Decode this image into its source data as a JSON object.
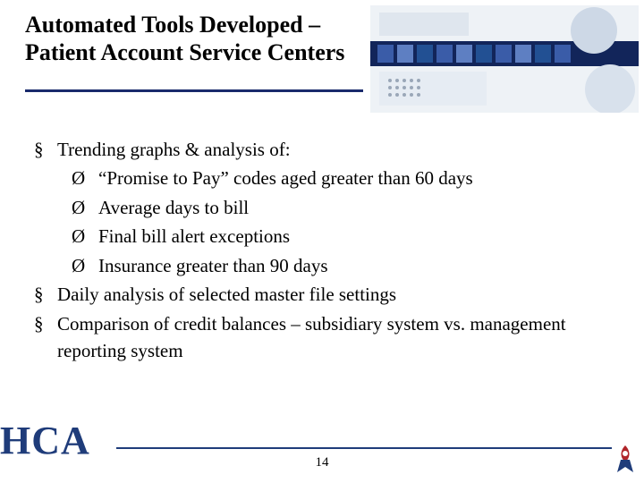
{
  "title_line1": "Automated Tools Developed –",
  "title_line2": "Patient Account Service Centers",
  "bullets": {
    "b1": "Trending graphs & analysis of:",
    "b1a": "“Promise to Pay” codes aged greater than 60 days",
    "b1b": "Average days to bill",
    "b1c": "Final bill alert exceptions",
    "b1d": "Insurance greater than 90 days",
    "b2": "Daily analysis of selected master file settings",
    "b3": "Comparison of credit balances – subsidiary system vs. management reporting system"
  },
  "footer": {
    "logo": "HCA",
    "page": "14"
  },
  "colors": {
    "rule": "#1f3c7a"
  }
}
